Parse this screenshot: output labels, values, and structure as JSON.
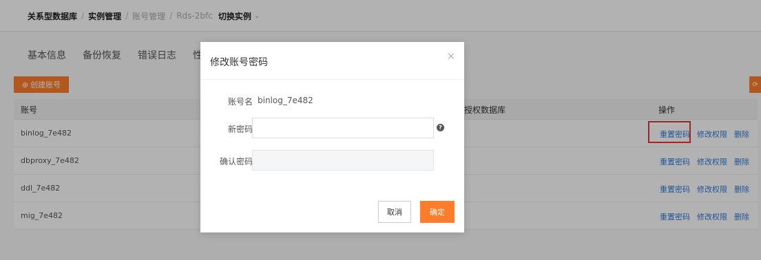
{
  "breadcrumb": {
    "root": "关系型数据库",
    "sep": "/",
    "instance_mgmt": "实例管理",
    "account_mgmt": "账号管理",
    "instance_id": "Rds-2bfc",
    "switch_label": "切换实例"
  },
  "tabs": [
    "基本信息",
    "备份恢复",
    "错误日志",
    "性"
  ],
  "toolbar": {
    "create_label": "创建账号"
  },
  "table": {
    "headers": {
      "account": "账号",
      "database": "授权数据库",
      "ops": "操作"
    },
    "rows": [
      {
        "name": "binlog_7e482"
      },
      {
        "name": "dbproxy_7e482"
      },
      {
        "name": "ddl_7e482"
      },
      {
        "name": "mig_7e482"
      }
    ],
    "ops": {
      "reset": "重置密码",
      "modify": "修改权限",
      "delete": "删除"
    }
  },
  "modal": {
    "title": "修改账号密码",
    "close": "×",
    "account_label": "账号名",
    "account_value": "binlog_7e482",
    "new_password_label": "新密码",
    "new_password_value": "",
    "confirm_password_label": "确认密码",
    "confirm_password_value": "",
    "cancel_label": "取消",
    "ok_label": "确定"
  },
  "colors": {
    "accent": "#ff7d2a",
    "link": "#2e7bd8",
    "highlight": "#e5333d"
  }
}
